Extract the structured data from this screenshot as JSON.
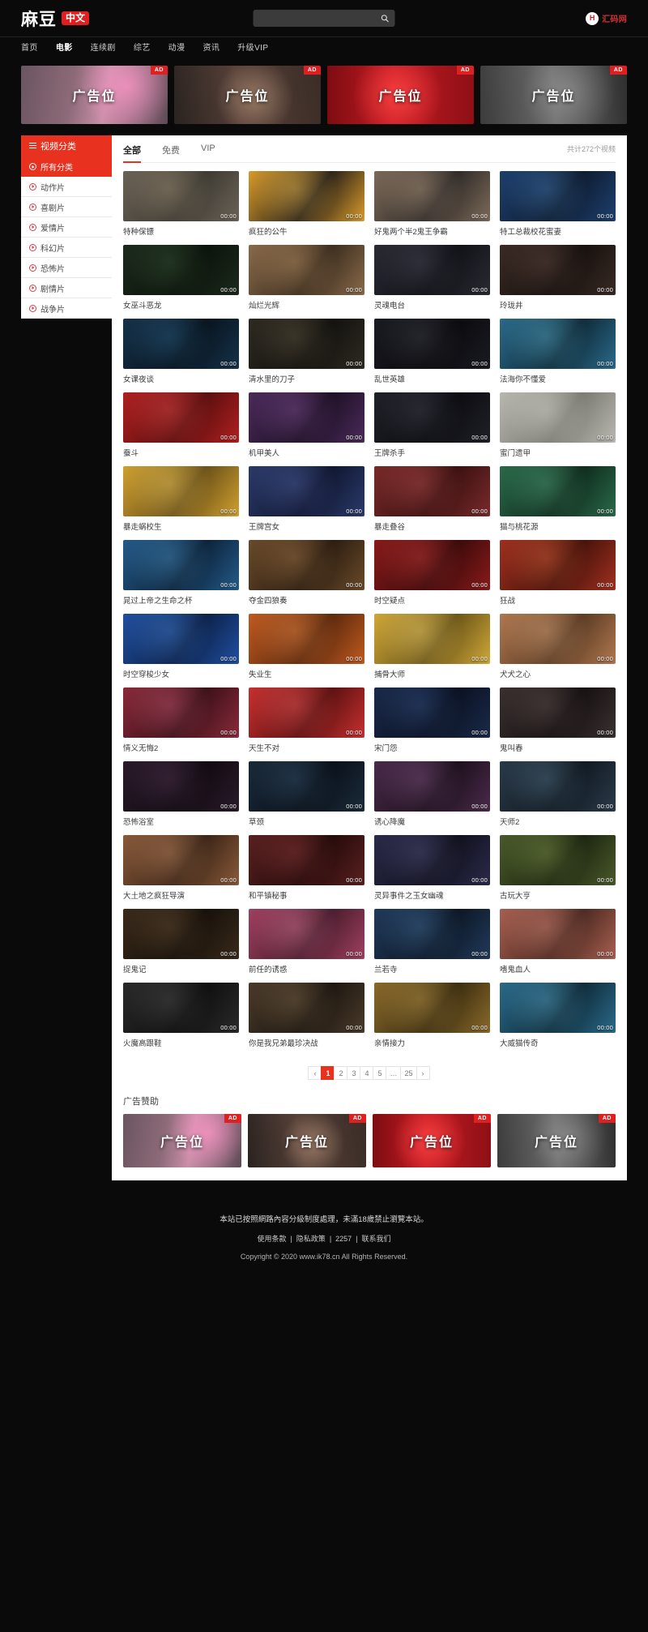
{
  "header": {
    "logo_text": "麻豆",
    "logo_badge": "中文",
    "search_placeholder": "",
    "search_value": "",
    "search_icon": "search-icon",
    "brand_mark": "H",
    "brand_name": "汇码网"
  },
  "nav": {
    "items": [
      {
        "label": "首页",
        "active": false
      },
      {
        "label": "电影",
        "active": true
      },
      {
        "label": "连续剧",
        "active": false
      },
      {
        "label": "综艺",
        "active": false
      },
      {
        "label": "动漫",
        "active": false
      },
      {
        "label": "资讯",
        "active": false
      },
      {
        "label": "升级VIP",
        "active": false
      }
    ]
  },
  "top_ads": {
    "badge": "AD",
    "items": [
      {
        "text": "广告位"
      },
      {
        "text": "广告位"
      },
      {
        "text": "广告位"
      },
      {
        "text": "广告位"
      }
    ]
  },
  "sidebar": {
    "header": "视频分类",
    "items": [
      {
        "label": "所有分类",
        "active": true
      },
      {
        "label": "动作片",
        "active": false
      },
      {
        "label": "喜剧片",
        "active": false
      },
      {
        "label": "爱情片",
        "active": false
      },
      {
        "label": "科幻片",
        "active": false
      },
      {
        "label": "恐怖片",
        "active": false
      },
      {
        "label": "剧情片",
        "active": false
      },
      {
        "label": "战争片",
        "active": false
      }
    ]
  },
  "main": {
    "tabs": [
      {
        "label": "全部",
        "active": true
      },
      {
        "label": "免费",
        "active": false
      },
      {
        "label": "VIP",
        "active": false
      }
    ],
    "count_text": "共计272个视频",
    "duration_label": "00:00",
    "videos": [
      {
        "title": "特种保镖",
        "duration": "00:00"
      },
      {
        "title": "疯狂的公牛",
        "duration": "00:00"
      },
      {
        "title": "好鬼两个半2鬼王争霸",
        "duration": "00:00"
      },
      {
        "title": "特工总裁校花蜜妻",
        "duration": "00:00"
      },
      {
        "title": "女巫斗恶龙",
        "duration": "00:00"
      },
      {
        "title": "灿烂光辉",
        "duration": "00:00"
      },
      {
        "title": "灵魂电台",
        "duration": "00:00"
      },
      {
        "title": "玲珑井",
        "duration": "00:00"
      },
      {
        "title": "女课夜谈",
        "duration": "00:00"
      },
      {
        "title": "清水里的刀子",
        "duration": "00:00"
      },
      {
        "title": "乱世英雄",
        "duration": "00:00"
      },
      {
        "title": "法海你不懂爱",
        "duration": "00:00"
      },
      {
        "title": "蚕斗",
        "duration": "00:00"
      },
      {
        "title": "机甲美人",
        "duration": "00:00"
      },
      {
        "title": "王牌杀手",
        "duration": "00:00"
      },
      {
        "title": "蜜门遗甲",
        "duration": "00:00"
      },
      {
        "title": "暴走蜗校生",
        "duration": "00:00"
      },
      {
        "title": "王牌宫女",
        "duration": "00:00"
      },
      {
        "title": "暴走叠谷",
        "duration": "00:00"
      },
      {
        "title": "猫与桃花源",
        "duration": "00:00"
      },
      {
        "title": "晁过上帝之生命之杯",
        "duration": "00:00"
      },
      {
        "title": "夺金四狼奏",
        "duration": "00:00"
      },
      {
        "title": "时空疑点",
        "duration": "00:00"
      },
      {
        "title": "狂战",
        "duration": "00:00"
      },
      {
        "title": "时空穿梭少女",
        "duration": "00:00"
      },
      {
        "title": "失业生",
        "duration": "00:00"
      },
      {
        "title": "捕骨大师",
        "duration": "00:00"
      },
      {
        "title": "犬犬之心",
        "duration": "00:00"
      },
      {
        "title": "情义无悔2",
        "duration": "00:00"
      },
      {
        "title": "天生不对",
        "duration": "00:00"
      },
      {
        "title": "宋门怨",
        "duration": "00:00"
      },
      {
        "title": "鬼叫春",
        "duration": "00:00"
      },
      {
        "title": "恐怖浴室",
        "duration": "00:00"
      },
      {
        "title": "草颈",
        "duration": "00:00"
      },
      {
        "title": "诱心降魔",
        "duration": "00:00"
      },
      {
        "title": "天师2",
        "duration": "00:00"
      },
      {
        "title": "大土地之疯狂导演",
        "duration": "00:00"
      },
      {
        "title": "和平镇秘事",
        "duration": "00:00"
      },
      {
        "title": "灵异事件之玉女幽魂",
        "duration": "00:00"
      },
      {
        "title": "古玩大亨",
        "duration": "00:00"
      },
      {
        "title": "捉鬼记",
        "duration": "00:00"
      },
      {
        "title": "前任的诱惑",
        "duration": "00:00"
      },
      {
        "title": "兰若寺",
        "duration": "00:00"
      },
      {
        "title": "嗜鬼血人",
        "duration": "00:00"
      },
      {
        "title": "火魔高跟鞋",
        "duration": "00:00"
      },
      {
        "title": "你是我兄弟最珍决战",
        "duration": "00:00"
      },
      {
        "title": "亲情接力",
        "duration": "00:00"
      },
      {
        "title": "大威猫传奇",
        "duration": "00:00"
      }
    ],
    "pagination": {
      "prev": "‹",
      "next": "›",
      "pages": [
        "1",
        "2",
        "3",
        "4",
        "5",
        "…",
        "25"
      ],
      "current": "1"
    }
  },
  "sponsor": {
    "title": "广告赞助",
    "badge": "AD",
    "items": [
      {
        "text": "广告位"
      },
      {
        "text": "广告位"
      },
      {
        "text": "广告位"
      },
      {
        "text": "广告位"
      }
    ]
  },
  "footer": {
    "notice": "本站已按照網路內容分級制度處理，未滿18歲禁止瀏覽本站。",
    "links": [
      "使用条款",
      "隐私政策",
      "2257",
      "联系我们"
    ],
    "separator": "|",
    "copyright": "Copyright © 2020 www.ik78.cn All Rights Reserved."
  }
}
